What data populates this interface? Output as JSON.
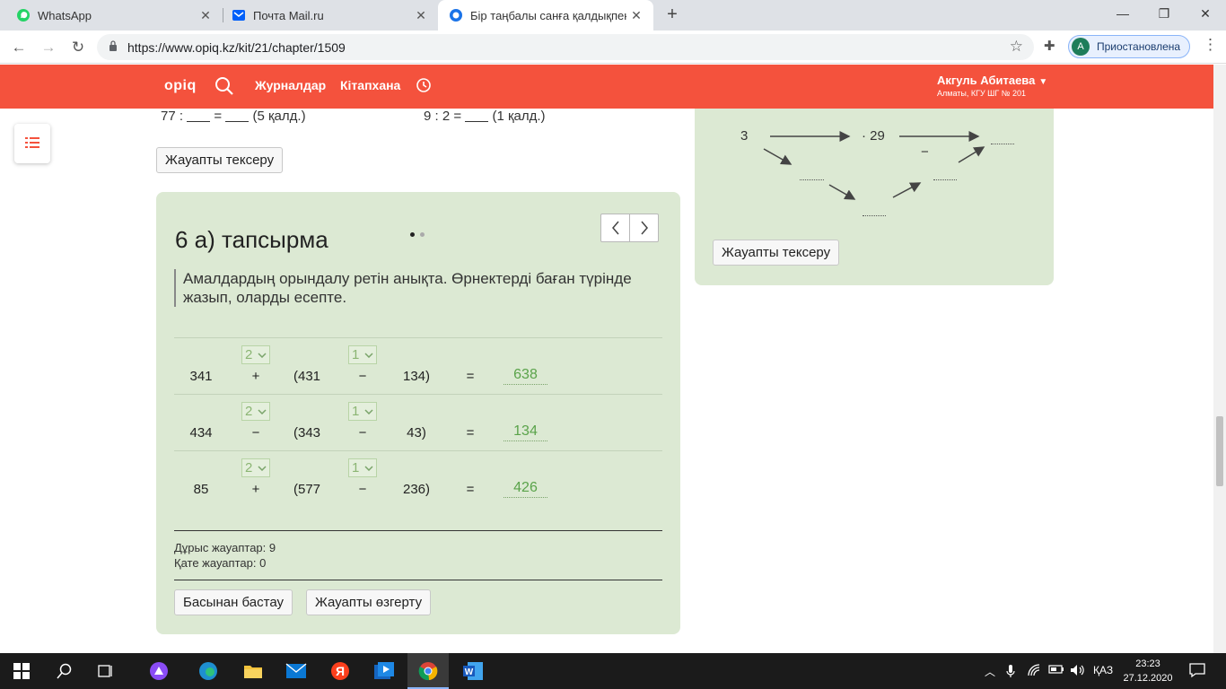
{
  "browser": {
    "tabs": [
      {
        "title": "WhatsApp",
        "icon": "whatsapp-icon",
        "close": "✕"
      },
      {
        "title": "Почта Mail.ru",
        "icon": "mail-icon",
        "close": "✕"
      },
      {
        "title": "Бір таңбалы санға қалдықпен бө",
        "icon": "opiq-tab-icon",
        "close": "✕"
      }
    ],
    "new_tab": "+",
    "url": "https://www.opiq.kz/kit/21/chapter/1509",
    "profile_initial": "A",
    "profile_label": "Приостановлена"
  },
  "site": {
    "logo": "opiq",
    "nav": [
      "Журналдар",
      "Кітапхана"
    ],
    "user_name": "Акгуль Абитаева",
    "school": "Алматы, КГУ ШГ № 201"
  },
  "top_exercise": {
    "left_prefix": "77 :",
    "left_eq": "=",
    "left_rem": "(5 қалд.)",
    "right_prefix": "9 : 2 =",
    "right_rem": "(1 қалд.)",
    "check_button": "Жауапты тексеру"
  },
  "diagram": {
    "start": "3",
    "op1": "· 29",
    "op2": "−",
    "check_button": "Жауапты тексеру"
  },
  "task": {
    "title": "6 а) тапсырма",
    "instruction": "Амалдардың орындалу ретін анықта. Өрнектерді баған түрінде жазып, оларды есепте.",
    "rows": [
      {
        "a": "341",
        "op1": "+",
        "b": "(431",
        "op2": "−",
        "c": "134)",
        "eq": "=",
        "order1": "2",
        "order2": "1",
        "answer": "638"
      },
      {
        "a": "434",
        "op1": "−",
        "b": "(343",
        "op2": "−",
        "c": "43)",
        "eq": "=",
        "order1": "2",
        "order2": "1",
        "answer": "134"
      },
      {
        "a": "85",
        "op1": "+",
        "b": "(577",
        "op2": "−",
        "c": "236)",
        "eq": "=",
        "order1": "2",
        "order2": "1",
        "answer": "426"
      }
    ],
    "correct": "Дұрыс жауаптар: 9",
    "wrong": "Қате жауаптар: 0",
    "restart_button": "Басынан бастау",
    "change_button": "Жауапты өзгерту"
  },
  "taskbar": {
    "lang": "ҚАЗ",
    "time": "23:23",
    "date": "27.12.2020"
  },
  "colors": {
    "header": "#f4523d",
    "card": "#dce9d3",
    "answer": "#5aa34a"
  }
}
